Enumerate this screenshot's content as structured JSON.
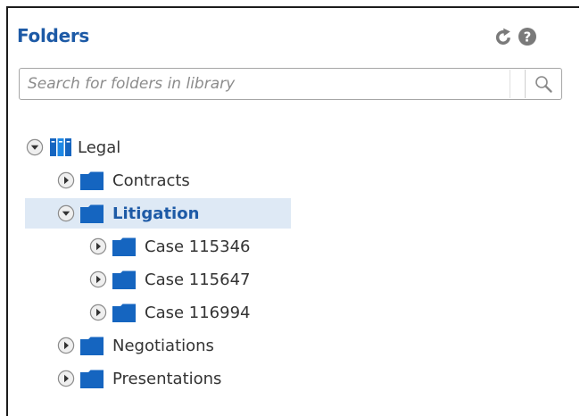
{
  "panel": {
    "title": "Folders",
    "header_icons": [
      "refresh-icon",
      "help-icon"
    ]
  },
  "search": {
    "placeholder": "Search for folders in library",
    "value": ""
  },
  "tree": {
    "root": {
      "label": "Legal",
      "expanded": true,
      "icon": "library-icon"
    },
    "items": [
      {
        "label": "Contracts",
        "expanded": false,
        "selected": false,
        "icon": "folder-icon"
      },
      {
        "label": "Litigation",
        "expanded": true,
        "selected": true,
        "icon": "folder-icon"
      },
      {
        "label": "Case 115346",
        "expanded": false,
        "selected": false,
        "icon": "folder-icon"
      },
      {
        "label": "Case 115647",
        "expanded": false,
        "selected": false,
        "icon": "folder-icon"
      },
      {
        "label": "Case 116994",
        "expanded": false,
        "selected": false,
        "icon": "folder-icon"
      },
      {
        "label": "Negotiations",
        "expanded": false,
        "selected": false,
        "icon": "folder-icon"
      },
      {
        "label": "Presentations",
        "expanded": false,
        "selected": false,
        "icon": "folder-icon"
      }
    ]
  },
  "colors": {
    "accent": "#1d5aa6",
    "folder": "#1565c0",
    "selected_bg": "#dee9f5"
  }
}
